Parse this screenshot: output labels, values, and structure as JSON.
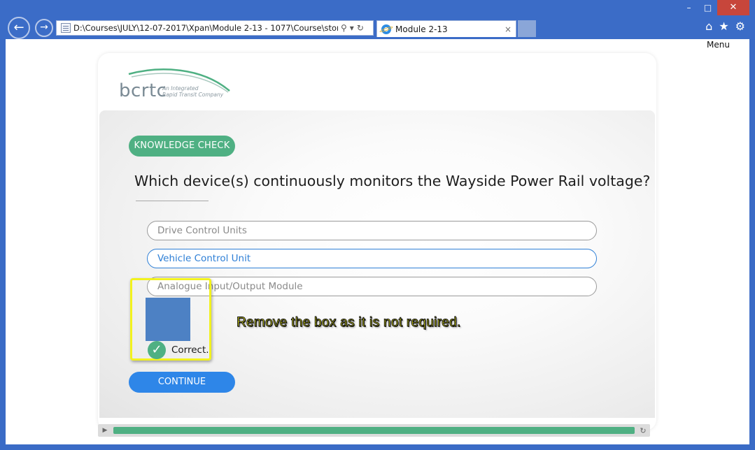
{
  "browser": {
    "url": "D:\\Courses\\JULY\\12-07-2017\\Xpan\\Module 2-13 - 1077\\Course\\story.ht",
    "tab_title": "Module 2-13",
    "tab_close": "×",
    "window_controls": {
      "minimize": "–",
      "maximize": "□",
      "close": "✕"
    },
    "nav_icons": {
      "back": "←",
      "forward": "→"
    },
    "address_icons": {
      "search": "⚲",
      "dropdown": "▾",
      "refresh": "↻"
    },
    "toolbar_icons": {
      "home": "⌂",
      "favorites": "★",
      "settings": "⚙"
    }
  },
  "course": {
    "menu_label": "Menu",
    "logo": {
      "name": "bcrtc",
      "tagline_line1": "An Integrated",
      "tagline_line2": "Rapid Transit Company"
    },
    "badge": "KNOWLEDGE CHECK",
    "question": "Which device(s) continuously monitors the Wayside Power Rail voltage?",
    "options": [
      {
        "label": "Drive Control Units",
        "selected": false
      },
      {
        "label": "Vehicle Control Unit",
        "selected": true
      },
      {
        "label": "Analogue Input/Output Module",
        "selected": false
      }
    ],
    "feedback": {
      "icon": "✓",
      "text": "Correct."
    },
    "annotation": "Remove the box as it is not required.",
    "continue_label": "CONTINUE",
    "player": {
      "play_icon": "▶",
      "replay_icon": "↻",
      "progress_fraction": 1.0
    }
  },
  "colors": {
    "accent_green": "#4fb083",
    "accent_blue": "#2e86e8",
    "selected_blue": "#2e7fd6",
    "annotation_yellow": "#f3f31a",
    "blue_box": "#4d81c4"
  }
}
